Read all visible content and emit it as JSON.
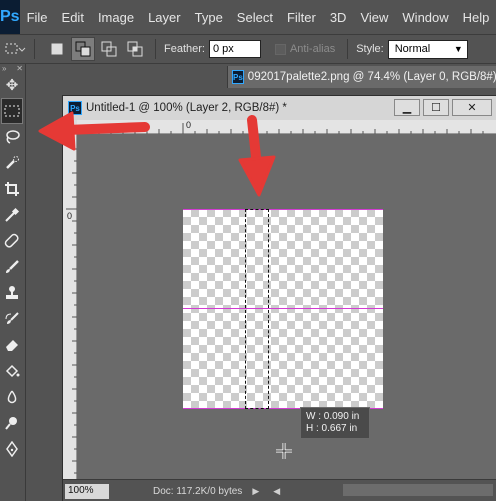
{
  "app": {
    "logo": "Ps",
    "menu": [
      "File",
      "Edit",
      "Image",
      "Layer",
      "Type",
      "Select",
      "Filter",
      "3D",
      "View",
      "Window",
      "Help"
    ]
  },
  "options_bar": {
    "feather_label": "Feather:",
    "feather_value": "0 px",
    "antialias_label": "Anti-alias",
    "style_label": "Style:",
    "style_value": "Normal"
  },
  "background_document": {
    "title": "092017palette2.png @ 74.4% (Layer 0, RGB/8#)"
  },
  "document": {
    "title": "Untitled-1 @ 100% (Layer 2, RGB/8#) *",
    "ruler_zero_h": "0",
    "ruler_zero_v": "0",
    "info_width": "W :   0.090 in",
    "info_height": "H :   0.667 in",
    "zoom": "100%",
    "doc_info": "Doc: 117.2K/0 bytes"
  },
  "colors": {
    "guide": "#d23bd2",
    "annotation_arrow": "#e53935",
    "ui_background": "#535353"
  },
  "tools": [
    "move-icon",
    "rectangular-marquee-icon",
    "lasso-icon",
    "quick-select-icon",
    "crop-icon",
    "eyedropper-icon",
    "healing-brush-icon",
    "brush-icon",
    "clone-stamp-icon",
    "history-brush-icon",
    "eraser-icon",
    "paint-bucket-icon",
    "blur-icon",
    "dodge-icon",
    "pen-icon"
  ]
}
